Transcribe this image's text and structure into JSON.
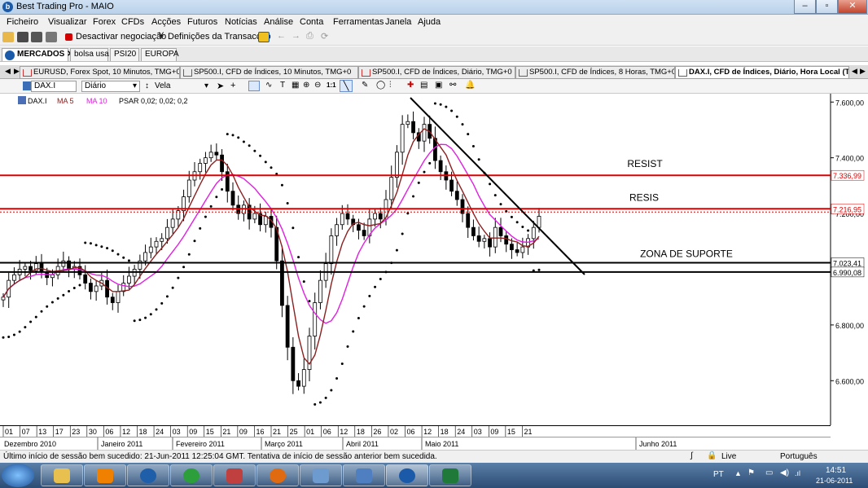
{
  "window": {
    "title": "Best Trading Pro - MAIO",
    "logo_letter": "b"
  },
  "menu": [
    "Ficheiro",
    "Visualizar",
    "Forex",
    "CFDs",
    "Acções",
    "Futuros",
    "Notícias",
    "Análise",
    "Conta",
    "Ferramentas",
    "Janela",
    "Ajuda"
  ],
  "toolbar": {
    "deactivate_label": "Desactivar negociação",
    "settings_label": "Definições da Transacção"
  },
  "workspace_tabs": [
    "MERCADOS",
    "bolsa usa",
    "PSI20",
    "EUROPA"
  ],
  "chart_tabs": [
    "EURUSD, Forex Spot, 10 Minutos, TMG+0",
    "SP500.I, CFD de Índices, 10 Minutos, TMG+0",
    "SP500.I, CFD de Índices, Diário, TMG+0",
    "SP500.I, CFD de Índices, 8 Horas, TMG+0",
    "DAX.I, CFD de Índices, Diário, Hora Local (T"
  ],
  "chart_toolbar": {
    "symbol": "DAX.I",
    "interval": "Diário",
    "chart_type": "Vela"
  },
  "indicators": {
    "symbol": "DAX.I",
    "ma5": "MA 5",
    "ma10": "MA 10",
    "psar": "PSAR 0,02; 0,02; 0,2"
  },
  "colors": {
    "ma5": "#8b2020",
    "ma10": "#e020e0",
    "resistance": "#e00000",
    "support": "#000000",
    "psar": "#000000"
  },
  "chart_data": {
    "type": "candlestick",
    "title": "",
    "y_ticks": [
      "7.600,00",
      "7.400,00",
      "7.200,00",
      "6.800,00",
      "6.600,00"
    ],
    "ylim": [
      6440,
      7630
    ],
    "price_labels": [
      "7.336,99",
      "7.216,95",
      "7.023,41",
      "6.990,08"
    ],
    "annotations": [
      "RESIST",
      "RESIS",
      "ZONA DE SUPORTE"
    ],
    "levels": [
      {
        "value": 7336.99,
        "color": "#e00000",
        "label": "RESIST"
      },
      {
        "value": 7216.95,
        "color": "#e00000",
        "label": "RESIS"
      },
      {
        "value": 7023.41,
        "color": "#000000",
        "label": "ZONA DE SUPORTE"
      },
      {
        "value": 6990.08,
        "color": "#000000"
      }
    ],
    "day_ticks": [
      "01",
      "07",
      "13",
      "17",
      "23",
      "30",
      "06",
      "12",
      "18",
      "24",
      "03",
      "09",
      "15",
      "21",
      "09",
      "16",
      "21",
      "25",
      "01",
      "06",
      "12",
      "18",
      "26",
      "02",
      "06",
      "12",
      "18",
      "24",
      "03",
      "09",
      "15",
      "21"
    ],
    "month_labels": [
      "Dezembro 2010",
      "Janeiro 2011",
      "Fevereiro 2011",
      "Março 2011",
      "Abril 2011",
      "Maio 2011",
      "Junho 2011"
    ],
    "closes": [
      6900,
      6960,
      6980,
      7000,
      7010,
      6995,
      7020,
      6990,
      6970,
      6980,
      7010,
      7030,
      7000,
      7010,
      6980,
      6950,
      6920,
      6940,
      6960,
      6900,
      6880,
      6920,
      6950,
      6975,
      7000,
      7030,
      7060,
      7080,
      7100,
      7110,
      7150,
      7180,
      7210,
      7260,
      7320,
      7350,
      7380,
      7400,
      7420,
      7410,
      7350,
      7280,
      7230,
      7200,
      7230,
      7180,
      7200,
      7160,
      7190,
      7150,
      7030,
      6870,
      6720,
      6600,
      6580,
      6640,
      6760,
      6880,
      6960,
      7020,
      7120,
      7160,
      7200,
      7180,
      7160,
      7140,
      7120,
      7180,
      7200,
      7180,
      7250,
      7330,
      7420,
      7520,
      7530,
      7490,
      7460,
      7520,
      7470,
      7390,
      7350,
      7320,
      7280,
      7250,
      7200,
      7150,
      7120,
      7100,
      7110,
      7080,
      7150,
      7120,
      7090,
      7070,
      7060,
      7080,
      7110,
      7150,
      7190
    ]
  },
  "status": {
    "message": "Último início de sessão bem sucedido: 21-Jun-2011 12:25:04 GMT. Tentativa de início de sessão anterior bem sucedida.",
    "connection": "Live",
    "language": "Português"
  },
  "taskbar": {
    "lang": "PT",
    "time": "14:51",
    "date": "21-06-2011"
  }
}
